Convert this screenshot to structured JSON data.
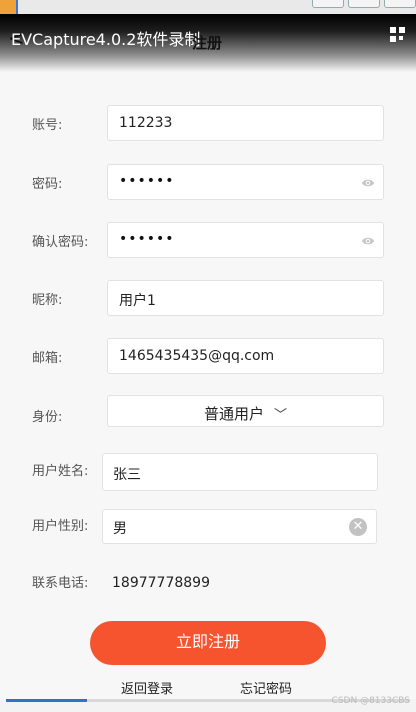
{
  "header": {
    "recording_title": "EVCapture4.0.2软件录制",
    "page_title": "注册",
    "back_glyph": "<"
  },
  "form": {
    "account": {
      "label": "账号:",
      "value": "112233"
    },
    "password": {
      "label": "密码:",
      "value": "••••••"
    },
    "confirm_password": {
      "label": "确认密码:",
      "value": "••••••"
    },
    "nickname": {
      "label": "昵称:",
      "value": "用户1"
    },
    "email": {
      "label": "邮箱:",
      "value": "1465435435@qq.com"
    },
    "identity": {
      "label": "身份:",
      "value": "普通用户",
      "chevron": "﹀"
    },
    "user_name": {
      "label": "用户姓名:",
      "value": "张三"
    },
    "user_gender": {
      "label": "用户性别:",
      "value": "男"
    },
    "phone": {
      "label": "联系电话:",
      "value": "18977778899"
    }
  },
  "actions": {
    "submit_label": "立即注册",
    "back_login_label": "返回登录",
    "forgot_password_label": "忘记密码"
  },
  "footer": {
    "watermark": "CSDN @8133CBS",
    "progress_fraction": 0.2
  },
  "colors": {
    "accent": "#f5542f",
    "progress": "#2d73c8"
  }
}
